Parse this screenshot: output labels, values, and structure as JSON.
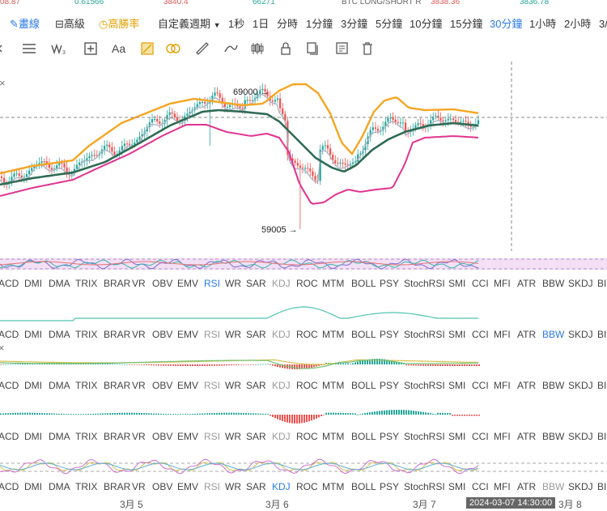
{
  "top_strip": [
    "08.87",
    "0.61566",
    "3840.4",
    "66271",
    "BTC LONG/SHORT R",
    "3838.36",
    "3836.78"
  ],
  "toolbar": {
    "draw_line": "畫線",
    "advanced": "高級",
    "win_rate": "高勝率",
    "custom_period": "自定義週期",
    "intervals": [
      "1秒",
      "1日",
      "分時",
      "1分鐘",
      "3分鐘",
      "5分鐘",
      "10分鐘",
      "15分鐘",
      "30分鐘",
      "1小時",
      "2小時",
      "3/"
    ],
    "active_interval": "30分鐘"
  },
  "drawing_tools": [
    "cursor-tool-icon",
    "horizontal-lines-icon",
    "wave-tool-icon",
    "add-box-icon",
    "text-tool-icon",
    "highlight-icon",
    "magnet-icon",
    "ruler-icon",
    "brush-icon",
    "candle-style-icon",
    "lock-icon",
    "copy-icon",
    "trash-icon"
  ],
  "text_tool_label": "Aa",
  "main_chart": {
    "high_label": "69000 →",
    "low_label": "59005 →"
  },
  "indicator_tabs": [
    "ACD",
    "DMI",
    "DMA",
    "TRIX",
    "BRAR",
    "VR",
    "OBV",
    "EMV",
    "RSI",
    "WR",
    "SAR",
    "KDJ",
    "ROC",
    "MTM",
    "BOLL",
    "PSY",
    "StochRSI",
    "SMI",
    "CCI",
    "MFI",
    "ATR",
    "BBW",
    "SKDJ",
    "BI"
  ],
  "indicator_rows": [
    {
      "active": "RSI",
      "dim": [
        "KDJ"
      ]
    },
    {
      "active": "BBW",
      "dim": [
        "RSI",
        "KDJ"
      ]
    },
    {
      "active": "",
      "dim": [
        "RSI",
        "KDJ"
      ]
    },
    {
      "active": "",
      "dim": [
        "RSI",
        "KDJ"
      ]
    },
    {
      "active": "KDJ",
      "dim": [
        "RSI",
        "BBW"
      ]
    }
  ],
  "x_axis": [
    "3月 5",
    "3月 6",
    "3月 7",
    "3月 8"
  ],
  "crosshair_time": "2024-03-07 14:30:00",
  "colors": {
    "up": "#26a69a",
    "down": "#ef5350",
    "boll_upper": "#f5a623",
    "boll_lower": "#e0338f",
    "boll_mid": "#2f6b55",
    "accent": "#2b7be5"
  }
}
